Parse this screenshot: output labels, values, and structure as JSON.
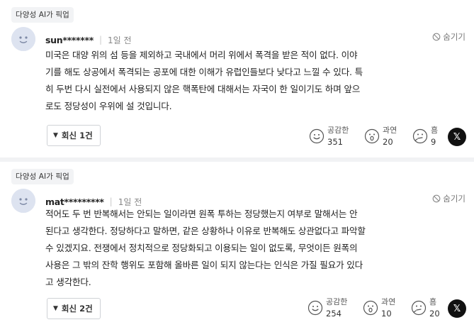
{
  "comments": [
    {
      "tag": "다양성 AI가 픽업",
      "username": "sun*******",
      "time": "1일 전",
      "hide_label": "숨기기",
      "body": "미국은 대양 위의 섬 등을 제외하고 국내에서 머리 위에서 폭격을 받은 적이 없다. 이야\n기를 해도 상공에서 폭격되는 공포에 대한 이해가 유럽인들보다 낮다고 느낄 수 있다. 특\n히 두번 다시 실전에서 사용되지 않은 핵폭탄에 대해서는 자국이 한 일이기도 하며 앞으\n로도 정당성이 우위에 설 것입니다.",
      "reply_label": "회신 1건",
      "reactions": [
        {
          "name": "empathy",
          "label": "공감한",
          "count": "351",
          "icon": "smile-icon"
        },
        {
          "name": "overdone",
          "label": "과연",
          "count": "20",
          "icon": "surprised-icon"
        },
        {
          "name": "hmm",
          "label": "흠",
          "count": "9",
          "icon": "thinking-icon"
        }
      ],
      "share_label": "𝕏"
    },
    {
      "tag": "다양성 AI가 픽업",
      "username": "mat*********",
      "time": "1일 전",
      "hide_label": "숨기기",
      "body": "적어도 두 번 반복해서는 안되는 일이라면 원폭 투하는 정당했는지 여부로 말해서는 안\n된다고 생각한다. 정당하다고 말하면, 같은 상황하나 이유로 반복해도 상관없다고 파악할\n수 있겠지요. 전쟁에서 정치적으로 정당화되고 이용되는 일이 없도록, 무엇이든 원폭의\n사용은 그 밖의 잔학 행위도 포함해 올바른 일이 되지 않는다는 인식은 가질 필요가 있다\n고 생각한다.",
      "reply_label": "회신 2건",
      "reactions": [
        {
          "name": "empathy",
          "label": "공감한",
          "count": "254",
          "icon": "smile-icon"
        },
        {
          "name": "overdone",
          "label": "과연",
          "count": "10",
          "icon": "surprised-icon"
        },
        {
          "name": "hmm",
          "label": "흠",
          "count": "20",
          "icon": "thinking-icon"
        }
      ],
      "share_label": "𝕏"
    }
  ]
}
